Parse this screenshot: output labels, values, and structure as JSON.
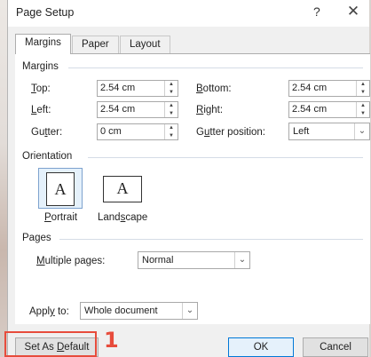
{
  "window": {
    "title": "Page Setup",
    "help": "?",
    "close": "✕"
  },
  "tabs": [
    "Margins",
    "Paper",
    "Layout"
  ],
  "margins": {
    "section_label": "Margins",
    "top": {
      "label": "Top:",
      "value": "2.54 cm"
    },
    "bottom": {
      "label": "Bottom:",
      "value": "2.54 cm"
    },
    "left": {
      "label": "Left:",
      "value": "2.54 cm"
    },
    "right": {
      "label": "Right:",
      "value": "2.54 cm"
    },
    "gutter": {
      "label": "Gutter:",
      "value": "0 cm"
    },
    "gutter_position": {
      "label": "Gutter position:",
      "value": "Left"
    }
  },
  "orientation": {
    "section_label": "Orientation",
    "portrait": "Portrait",
    "landscape": "Landscape",
    "glyph": "A"
  },
  "pages": {
    "section_label": "Pages",
    "multiple_pages_label": "Multiple pages:",
    "multiple_pages_value": "Normal"
  },
  "apply": {
    "label": "Apply to:",
    "value": "Whole document"
  },
  "buttons": {
    "set_default": "Set As Default",
    "ok": "OK",
    "cancel": "Cancel"
  },
  "annotation": {
    "number": "1",
    "color": "#e74c3c"
  }
}
